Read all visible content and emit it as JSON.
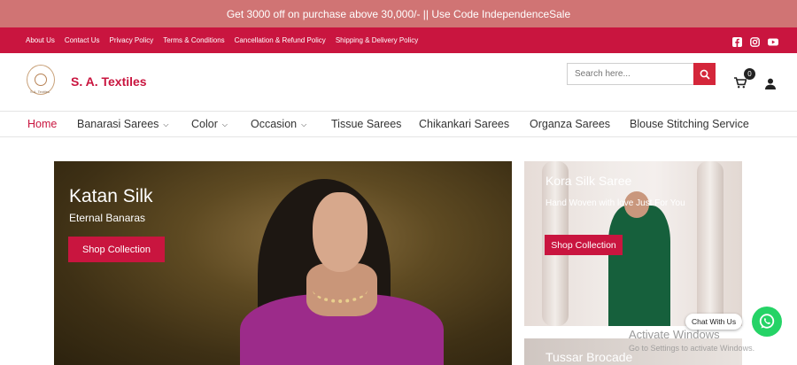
{
  "promo": {
    "text": "Get 3000 off on purchase above 30,000/- || Use Code IndependenceSale"
  },
  "topbar": {
    "links": [
      "About Us",
      "Contact Us",
      "Privacy Policy",
      "Terms & Conditions",
      "Cancellation & Refund Policy",
      "Shipping & Delivery Policy"
    ],
    "social": [
      "facebook-icon",
      "instagram-icon",
      "youtube-icon"
    ]
  },
  "header": {
    "brand": "S. A. Textiles",
    "logo_caption": "S.A. Textiles",
    "search_placeholder": "Search here...",
    "cart_count": "0"
  },
  "nav": {
    "items": [
      {
        "label": "Home",
        "dropdown": false,
        "active": true
      },
      {
        "label": "Banarasi Sarees",
        "dropdown": true
      },
      {
        "label": "Color",
        "dropdown": true
      },
      {
        "label": "Occasion",
        "dropdown": true
      },
      {
        "label": "Tissue Sarees",
        "dropdown": false
      },
      {
        "label": "Chikankari Sarees",
        "dropdown": false
      },
      {
        "label": "Organza Sarees",
        "dropdown": false
      },
      {
        "label": "Blouse Stitching Service",
        "dropdown": false
      }
    ]
  },
  "hero": {
    "title": "Katan Silk",
    "subtitle": "Eternal Banaras",
    "button": "Shop Collection"
  },
  "side_banners": [
    {
      "title": "Kora Silk Saree",
      "subtitle": "Hand Woven with love Just For You",
      "button": "Shop Collection"
    },
    {
      "title": "Tussar Brocade"
    }
  ],
  "chat": {
    "label": "Chat With Us"
  },
  "watermark": {
    "line1": "Activate Windows",
    "line2": "Go to Settings to activate Windows."
  },
  "colors": {
    "accent": "#c9153f",
    "promo_bg": "#d07474",
    "whatsapp": "#25d366"
  }
}
